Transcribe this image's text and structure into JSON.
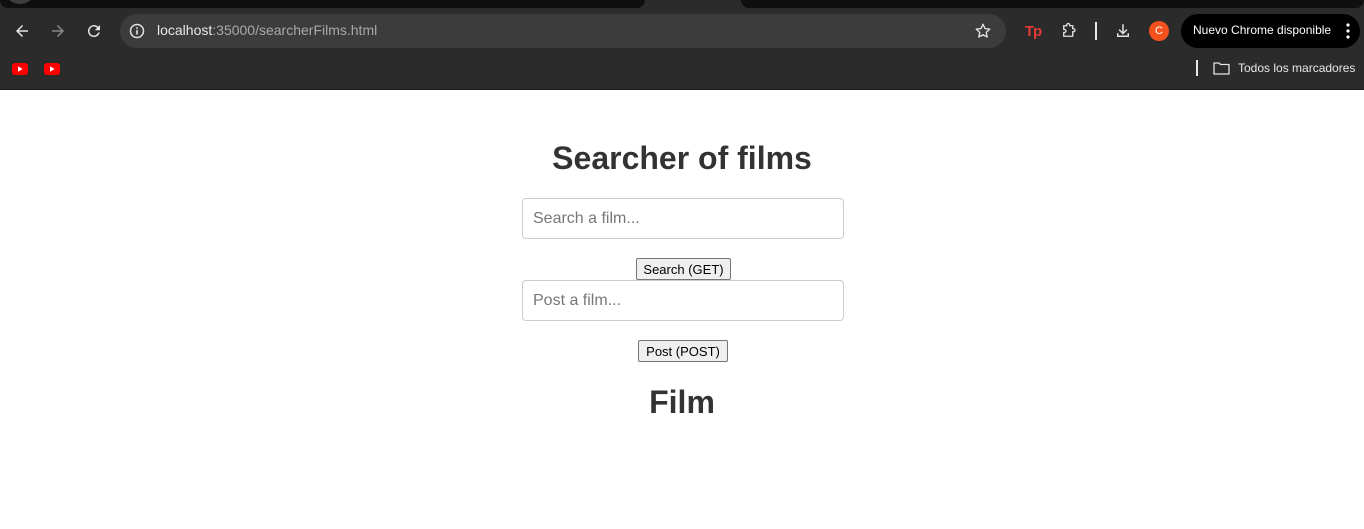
{
  "browser": {
    "url_host": "localhost",
    "url_rest": ":35000/searcherFilms.html",
    "update_label": "Nuevo Chrome disponible",
    "avatar_letter": "C",
    "extension_label": "Tp",
    "all_bookmarks_label": "Todos los marcadores",
    "icons": [
      "back-icon",
      "forward-icon",
      "reload-icon",
      "info-icon",
      "star-icon",
      "tp-extension-icon",
      "puzzle-icon",
      "download-icon",
      "kebab-icon",
      "youtube-icon",
      "folder-icon"
    ]
  },
  "page": {
    "title": "Searcher of films",
    "search": {
      "placeholder": "Search a film...",
      "value": "",
      "button_label": "Search (GET)"
    },
    "post": {
      "placeholder": "Post a film...",
      "value": "",
      "button_label": "Post (POST)"
    },
    "result_heading": "Film"
  },
  "colors": {
    "heading": "#333333",
    "chrome_bg": "#2b2b2b",
    "avatar": "#f4511e",
    "tp_red": "#e53935",
    "youtube_red": "#ff0000"
  }
}
